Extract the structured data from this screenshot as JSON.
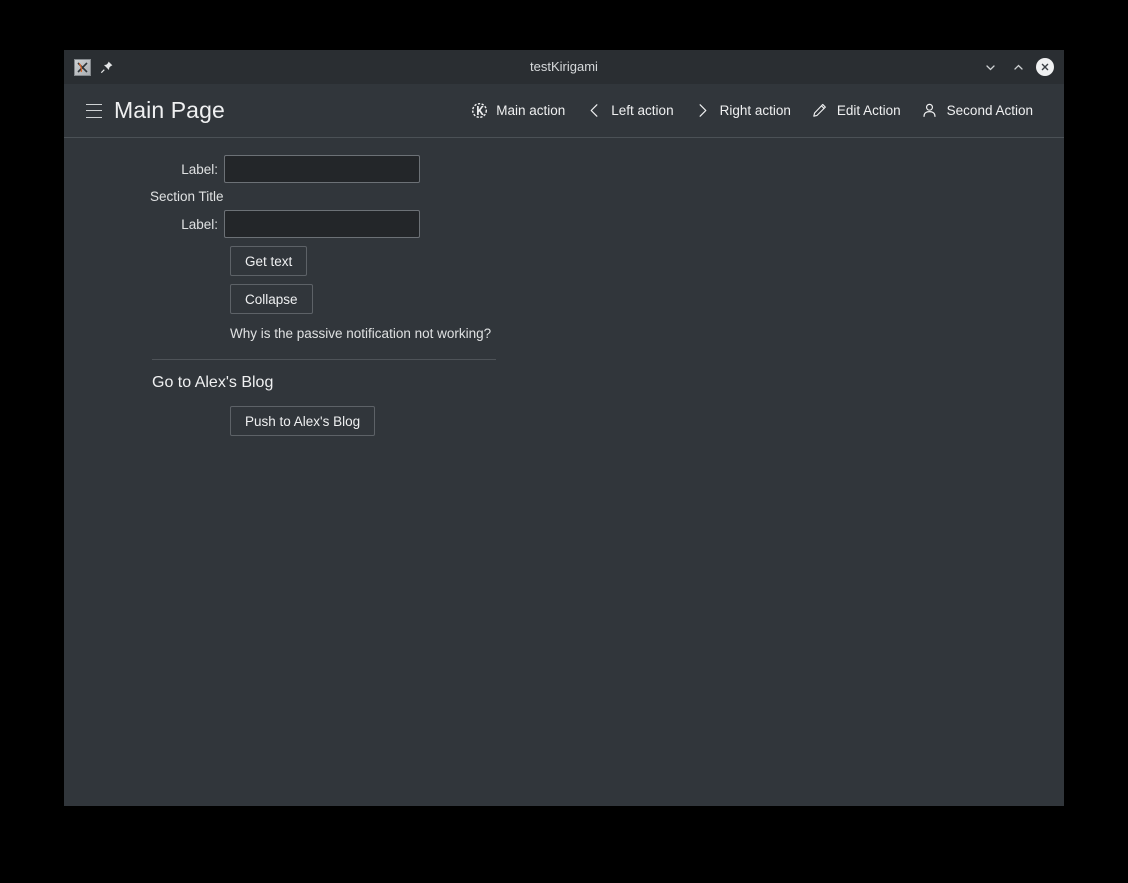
{
  "colors": {
    "desktop": "#000000",
    "window_bg": "#31363b",
    "titlebar_bg": "#2a2e32",
    "field_bg": "#232629",
    "border": "#5d6267",
    "text": "#eff0f1"
  },
  "titlebar": {
    "app_icon": "x-application-icon",
    "pin_icon": "pin-icon",
    "title": "testKirigami",
    "minimize_icon": "chevron-down-icon",
    "maximize_icon": "chevron-up-icon",
    "close_icon": "close-icon"
  },
  "header": {
    "menu_icon": "hamburger-menu-icon",
    "title": "Main Page",
    "actions": [
      {
        "label": "Main action",
        "icon": "kde-logo-icon"
      },
      {
        "label": "Left action",
        "icon": "chevron-left-icon"
      },
      {
        "label": "Right action",
        "icon": "chevron-right-icon"
      },
      {
        "label": "Edit Action",
        "icon": "pencil-edit-icon"
      },
      {
        "label": "Second Action",
        "icon": "user-person-icon"
      }
    ]
  },
  "form": {
    "label_1": "Label:",
    "field_1_value": "",
    "field_1_placeholder": "",
    "section_title": "Section Title",
    "label_2": "Label:",
    "field_2_value": "",
    "field_2_placeholder": "",
    "get_text_button": "Get text",
    "collapse_button": "Collapse",
    "note": "Why is the passive notification not working?"
  },
  "blog": {
    "title": "Go to Alex's Blog",
    "button": "Push to Alex's Blog"
  }
}
